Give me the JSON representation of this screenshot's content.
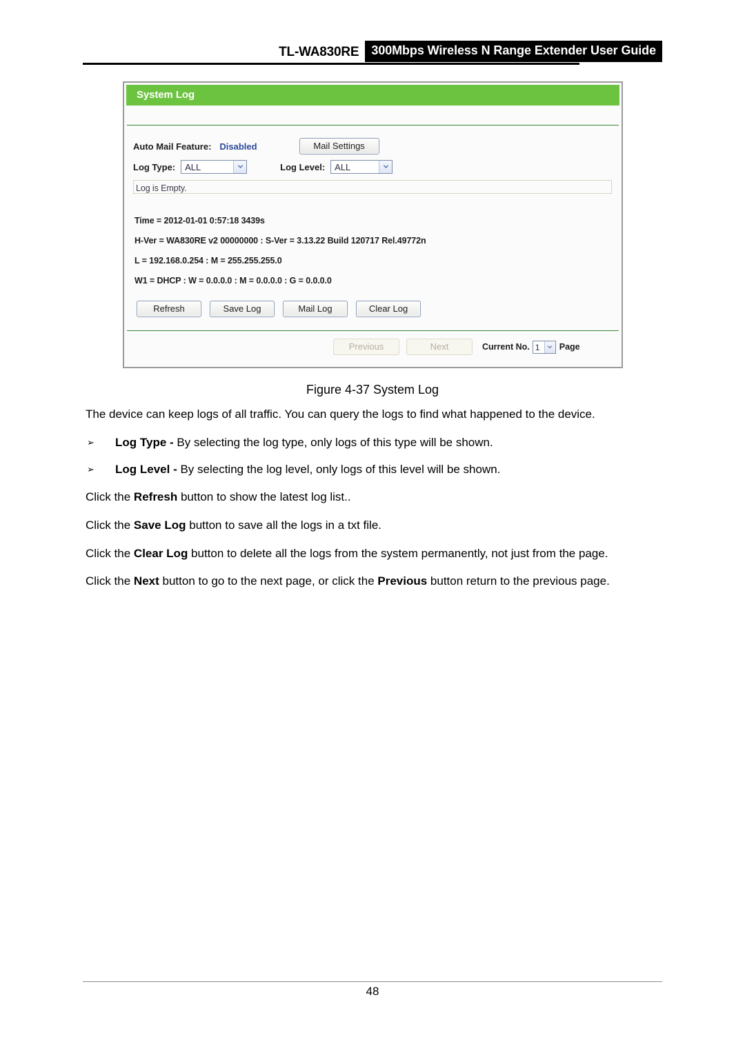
{
  "header": {
    "model": "TL-WA830RE",
    "guide_title": "300Mbps Wireless N Range Extender User Guide"
  },
  "figure": {
    "panel_title": "System Log",
    "accent_green": "#6cc340",
    "value_blue": "#2b4a9b",
    "auto_mail": {
      "label": "Auto Mail Feature:",
      "value": "Disabled",
      "button": "Mail Settings"
    },
    "log_type": {
      "label": "Log Type:",
      "value": "ALL",
      "options": [
        "ALL"
      ]
    },
    "log_level": {
      "label": "Log Level:",
      "value": "ALL",
      "options": [
        "ALL"
      ]
    },
    "log_box": {
      "text": "Log is Empty."
    },
    "info_lines": [
      "Time = 2012-01-01 0:57:18 3439s",
      "H-Ver = WA830RE v2 00000000 : S-Ver = 3.13.22 Build 120717 Rel.49772n",
      "L = 192.168.0.254 : M = 255.255.255.0",
      "W1 = DHCP : W = 0.0.0.0 : M = 0.0.0.0 : G = 0.0.0.0"
    ],
    "buttons": {
      "refresh": "Refresh",
      "save_log": "Save Log",
      "mail_log": "Mail Log",
      "clear_log": "Clear Log"
    },
    "pager": {
      "previous": "Previous",
      "next": "Next",
      "current_label": "Current No.",
      "current_value": "1",
      "current_options": [
        "1"
      ],
      "page_suffix": "Page"
    },
    "caption": "Figure 4-37 System Log"
  },
  "body": {
    "intro": "The device can keep logs of all traffic. You can query the logs to find what happened to the device.",
    "bullets": [
      {
        "mark": "➢",
        "term": "Log Type -",
        "rest": " By selecting the log type, only logs of this type will be shown."
      },
      {
        "mark": "➢",
        "term": "Log Level -",
        "rest": " By selecting the log level, only logs of this level will be shown."
      }
    ],
    "paragraphs": [
      {
        "pre": "Click the ",
        "term": "Refresh",
        "post": " button to show the latest log list.."
      },
      {
        "pre": "Click the ",
        "term": "Save Log",
        "post": " button to save all the logs in a txt file."
      },
      {
        "pre": "Click the ",
        "term": "Clear Log",
        "post": " button to delete all the logs from the system permanently, not just from the page."
      },
      {
        "pre": "Click the ",
        "term": "Next",
        "mid": " button to go to the next page, or click the ",
        "term2": "Previous",
        "post": " button return to the previous page."
      }
    ]
  },
  "footer": {
    "page_number": "48"
  }
}
